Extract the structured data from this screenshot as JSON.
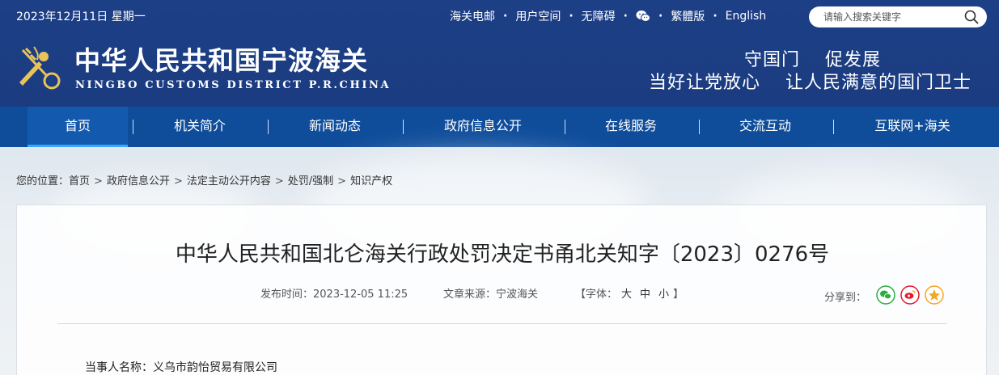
{
  "header": {
    "date": "2023年12月11日 星期一",
    "links": [
      "海关电邮",
      "用户空间",
      "无障碍",
      "繁體版",
      "English"
    ],
    "search_placeholder": "请输入搜索关键字",
    "title": "中华人民共和国宁波海关",
    "subtitle": "NINGBO CUSTOMS DISTRICT P.R.CHINA",
    "slogan_line1": "守国门　 促发展",
    "slogan_line2": "当好让党放心　 让人民满意的国门卫士"
  },
  "nav": {
    "items": [
      "首页",
      "机关简介",
      "新闻动态",
      "政府信息公开",
      "在线服务",
      "交流互动",
      "互联网+海关"
    ]
  },
  "breadcrumb": {
    "prefix": "您的位置：",
    "items": [
      "首页",
      "政府信息公开",
      "法定主动公开内容",
      "处罚/强制",
      "知识产权"
    ]
  },
  "article": {
    "title": "中华人民共和国北仑海关行政处罚决定书甬北关知字〔2023〕0276号",
    "publish_time": "发布时间：2023-12-05 11:25",
    "source": "文章来源：宁波海关",
    "font_label_open": "【字体：",
    "font_sizes": [
      "大",
      "中",
      "小"
    ],
    "font_label_close": "】",
    "share_label": "分享到：",
    "party": "当事人名称：义乌市韵怡贸易有限公司"
  },
  "colors": {
    "header_bg": "#1d3f86",
    "nav_bg": "#0f4d9b",
    "nav_active_underline": "#3aa6ff",
    "wechat_green": "#2aae43",
    "weibo_red": "#e6162d",
    "qzone_yellow": "#f5a623"
  },
  "icons": {
    "logo": "customs-emblem-icon",
    "search": "search-icon",
    "wechat": "wechat-icon",
    "share": [
      "wechat-share-icon",
      "weibo-share-icon",
      "qzone-share-icon"
    ]
  }
}
